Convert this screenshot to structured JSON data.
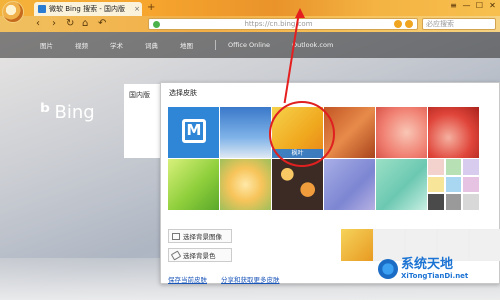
{
  "browser": {
    "tab_title": "微软 Bing 搜索 - 国内版",
    "tab_close": "×",
    "tab_add": "+",
    "window_buttons": [
      "≡",
      "—",
      "☐",
      "✕"
    ],
    "address_text": "https://cn.bing.com",
    "search_placeholder": "必应搜索",
    "nav_symbols": {
      "back": "‹",
      "forward": "›",
      "refresh": "↻",
      "home": "⌂",
      "undo": "↶"
    }
  },
  "bing": {
    "nav_links": [
      "图片",
      "视频",
      "学术",
      "词典",
      "地图",
      "Office Online",
      "Outlook.com"
    ],
    "logo_text": "Bing",
    "region_label": "国内版"
  },
  "dialog": {
    "title": "选择皮肤",
    "selected_caption": "枫叶",
    "actions": [
      "选择背景图像",
      "选择背景色"
    ],
    "links": [
      "保存当前皮肤",
      "分享和获取更多皮肤"
    ]
  },
  "tiles": [
    {
      "name": "tile-maxthon-blue",
      "bg": "#2f86d6"
    },
    {
      "name": "tile-sky",
      "bg": "linear-gradient(180deg,#3a78c9,#7fb3e8 60%,#dfe9f3)"
    },
    {
      "name": "tile-maple-leaf",
      "bg": "linear-gradient(135deg,#f5d24b,#f0a81e 60%,#e8841a)"
    },
    {
      "name": "tile-wood",
      "bg": "linear-gradient(135deg,#c25524,#e78b4a 50%,#a8431c)"
    },
    {
      "name": "tile-pink-flower",
      "bg": "radial-gradient(circle at 60% 50%,#f9c6b5,#f08072 60%,#d9554a)"
    },
    {
      "name": "tile-red-flower",
      "bg": "radial-gradient(circle at 40% 60%,#f5b0a0,#e0453a 55%,#a8231c)"
    },
    {
      "name": "tile-green-leaf",
      "bg": "linear-gradient(135deg,#d8f07a,#8fcf3c 55%,#5aa82a)"
    },
    {
      "name": "tile-yellow-flower",
      "bg": "radial-gradient(circle at 50% 50%,#ffe8a8,#f7c45a 45%,#9dbf5a)"
    },
    {
      "name": "tile-bokeh",
      "bg": "radial-gradient(circle at 30% 30%,#f7c863 0 12%,transparent 13%),radial-gradient(circle at 70% 60%,#f09b3c 0 15%,transparent 16%),#3b2b24"
    },
    {
      "name": "tile-purple",
      "bg": "linear-gradient(135deg,#a8aee6,#7c86d2 60%,#b7b0e3)"
    },
    {
      "name": "tile-mint",
      "bg": "linear-gradient(135deg,#9ae0c5,#6cc8b2 55%,#c9efe2)"
    },
    {
      "name": "tile-color-grid",
      "bg": "#ffffff"
    }
  ],
  "swatches": [
    "#f3d1cc",
    "#b8e0b5",
    "#d7ccee",
    "#f7e59a",
    "#a9d6f0",
    "#e7c3e3",
    "#4a4a4a",
    "#9a9a9a",
    "#d8d8d8"
  ],
  "preview_thumbs": [
    "linear-gradient(135deg,#f6d35a,#e89a22)",
    "#f0f0f0",
    "#f0f0f0",
    "#f0f0f0",
    "#f0f0f0"
  ],
  "watermark": {
    "name": "系统天地",
    "url": "XiTongTianDi.net"
  },
  "colors": {
    "accent": "#f0a81e",
    "highlight": "#e02020",
    "link": "#1a55b8"
  }
}
